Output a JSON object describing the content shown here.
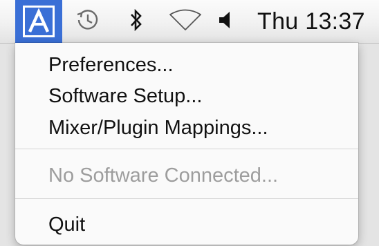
{
  "menubar": {
    "status_items": [
      {
        "icon": "app-a-icon",
        "active": true
      },
      {
        "icon": "time-machine-icon"
      },
      {
        "icon": "bluetooth-icon"
      },
      {
        "icon": "wifi-icon"
      },
      {
        "icon": "volume-icon"
      }
    ],
    "clock": "Thu 13:37",
    "accent_color": "#3a6fd6"
  },
  "menu": {
    "items": [
      {
        "label": "Preferences...",
        "enabled": true
      },
      {
        "label": "Software Setup...",
        "enabled": true
      },
      {
        "label": "Mixer/Plugin Mappings...",
        "enabled": true
      },
      {
        "label": "No Software Connected...",
        "enabled": false
      },
      {
        "label": "Quit",
        "enabled": true
      }
    ]
  }
}
